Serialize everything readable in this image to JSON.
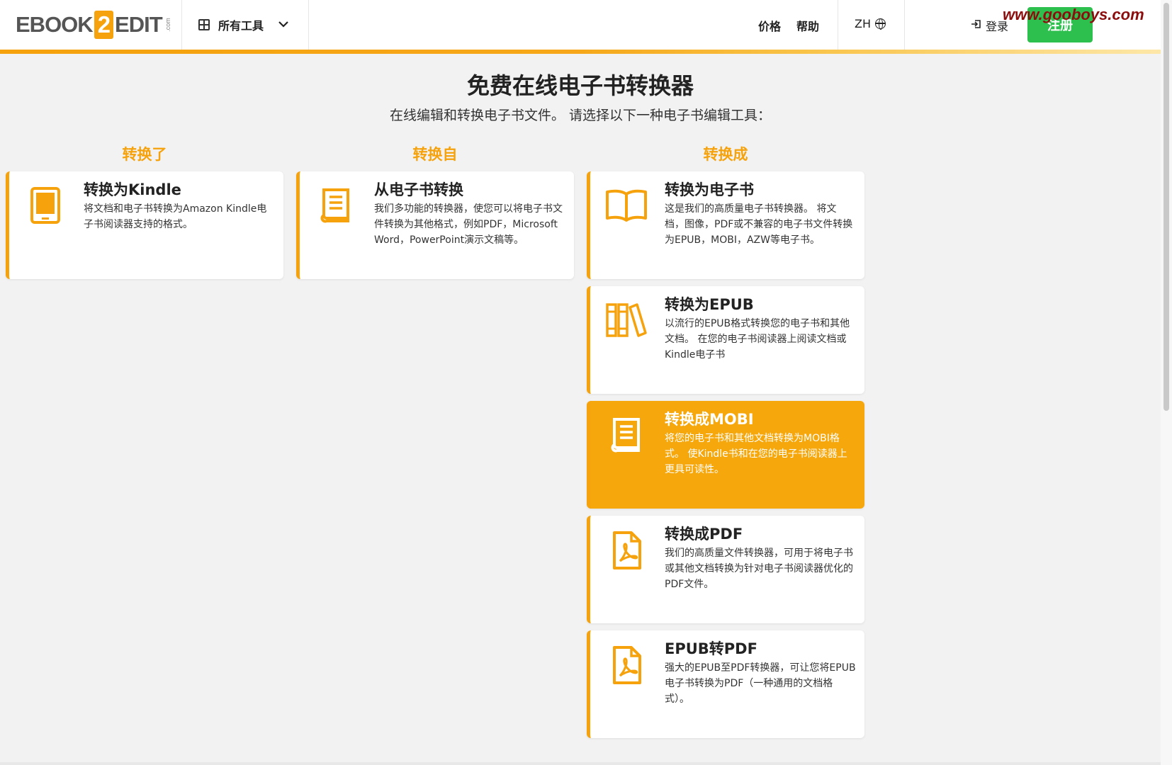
{
  "header": {
    "logo_left": "EBOOK",
    "logo_mid": "2",
    "logo_right": "EDIT",
    "logo_suffix": ".com",
    "tools_label": "所有工具",
    "pricing": "价格",
    "help": "帮助",
    "language": "ZH",
    "login": "登录",
    "register": "注册",
    "watermark": "www.gooboys.com"
  },
  "main": {
    "title": "免费在线电子书转换器",
    "subtitle": "在线编辑和转换电子书文件。 请选择以下一种电子书编辑工具："
  },
  "columns": [
    {
      "heading": "转换了"
    },
    {
      "heading": "转换自"
    },
    {
      "heading": "转换成"
    }
  ],
  "cards": {
    "kindle": {
      "title": "转换为Kindle",
      "desc": "将文档和电子书转换为Amazon Kindle电子书阅读器支持的格式。",
      "icon": "tablet-icon"
    },
    "from_ebook": {
      "title": "从电子书转换",
      "desc": "我们多功能的转换器，使您可以将电子书文件转换为其他格式，例如PDF，Microsoft Word，PowerPoint演示文稿等。",
      "icon": "book-icon"
    },
    "to_ebook": {
      "title": "转换为电子书",
      "desc": "这是我们的高质量电子书转换器。 将文档，图像，PDF或不兼容的电子书文件转换为EPUB，MOBI，AZW等电子书。",
      "icon": "open-book-icon"
    },
    "to_epub": {
      "title": "转换为EPUB",
      "desc": "以流行的EPUB格式转换您的电子书和其他文档。 在您的电子书阅读器上阅读文档或Kindle电子书",
      "icon": "library-icon"
    },
    "to_mobi": {
      "title": "转换成MOBI",
      "desc": "将您的电子书和其他文档转换为MOBI格式。 使Kindle书和在您的电子书阅读器上更具可读性。",
      "icon": "book-icon"
    },
    "to_pdf": {
      "title": "转换成PDF",
      "desc": "我们的高质量文件转换器，可用于将电子书或其他文档转换为针对电子书阅读器优化的PDF文件。",
      "icon": "pdf-file-icon"
    },
    "epub_to_pdf": {
      "title": "EPUB转PDF",
      "desc": "强大的EPUB至PDF转换器，可让您将EPUB电子书转换为PDF（一种通用的文档格式）。",
      "icon": "pdf-file-icon"
    }
  },
  "colors": {
    "accent": "#f5a20c",
    "register_green": "#2ec04f",
    "background": "#f2f2f2"
  }
}
